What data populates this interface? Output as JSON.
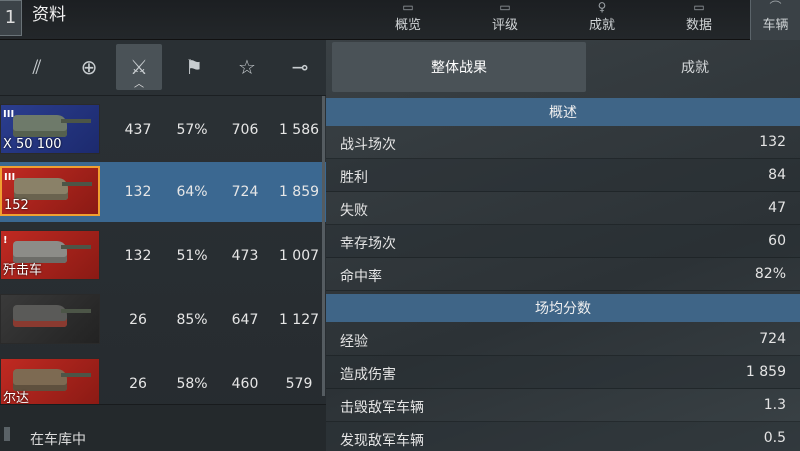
{
  "header": {
    "back_label": "1",
    "title": "资料",
    "tabs": [
      {
        "label": "概览",
        "icon": "overview-icon"
      },
      {
        "label": "评级",
        "icon": "rating-icon"
      },
      {
        "label": "成就",
        "icon": "achievements-icon"
      },
      {
        "label": "数据",
        "icon": "data-icon"
      },
      {
        "label": "车辆",
        "icon": "vehicles-icon"
      }
    ]
  },
  "filters": [
    {
      "name": "tier-filter",
      "glyph": "⫽"
    },
    {
      "name": "nation-filter",
      "glyph": "⊕"
    },
    {
      "name": "battles-sort",
      "glyph": "⚔"
    },
    {
      "name": "winrate-sort",
      "glyph": "⚑"
    },
    {
      "name": "mastery-sort",
      "glyph": "☆"
    },
    {
      "name": "damage-sort",
      "glyph": "⊸"
    }
  ],
  "vehicles": [
    {
      "tier": "III",
      "name": "X 50 100",
      "battles": "437",
      "winrate": "57%",
      "avg_xp": "706",
      "avg_damage": "1 586",
      "color": "blue"
    },
    {
      "tier": "III",
      "name": "152",
      "battles": "132",
      "winrate": "64%",
      "avg_xp": "724",
      "avg_damage": "1 859",
      "color": "red",
      "selected": true
    },
    {
      "tier": "!",
      "name": "歼击车",
      "battles": "132",
      "winrate": "51%",
      "avg_xp": "473",
      "avg_damage": "1 007",
      "color": "red"
    },
    {
      "tier": "",
      "name": "",
      "battles": "26",
      "winrate": "85%",
      "avg_xp": "647",
      "avg_damage": "1 127",
      "color": "dark"
    },
    {
      "tier": "",
      "name": "尔达",
      "battles": "26",
      "winrate": "58%",
      "avg_xp": "460",
      "avg_damage": "579",
      "color": "red"
    }
  ],
  "garage_filter_label": "在车库中",
  "right": {
    "tab_active": "整体战果",
    "tab_inactive": "成就",
    "overview_title": "概述",
    "overview": [
      {
        "label": "战斗场次",
        "value": "132"
      },
      {
        "label": "胜利",
        "value": "84"
      },
      {
        "label": "失败",
        "value": "47"
      },
      {
        "label": "幸存场次",
        "value": "60"
      },
      {
        "label": "命中率",
        "value": "82%"
      }
    ],
    "avg_title": "场均分数",
    "avg": [
      {
        "label": "经验",
        "value": "724"
      },
      {
        "label": "造成伤害",
        "value": "1 859"
      },
      {
        "label": "击毁敌军车辆",
        "value": "1.3"
      },
      {
        "label": "发现敌军车辆",
        "value": "0.5"
      }
    ]
  }
}
